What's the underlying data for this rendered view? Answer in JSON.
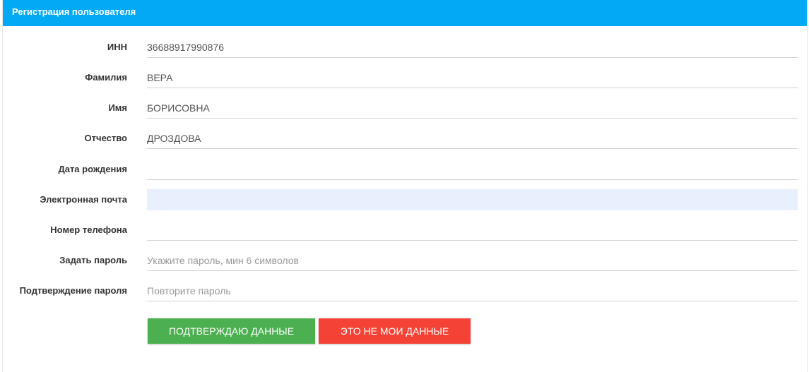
{
  "panel": {
    "title": "Регистрация пользователя"
  },
  "form": {
    "fields": [
      {
        "label": "ИНН",
        "value": "36688917990876",
        "placeholder": ""
      },
      {
        "label": "Фамилия",
        "value": "ВЕРА",
        "placeholder": ""
      },
      {
        "label": "Имя",
        "value": "БОРИСОВНА",
        "placeholder": ""
      },
      {
        "label": "Отчество",
        "value": "ДРОЗДОВА",
        "placeholder": ""
      },
      {
        "label": "Дата рождения",
        "value": "",
        "placeholder": ""
      },
      {
        "label": "Электронная почта",
        "value": "",
        "placeholder": ""
      },
      {
        "label": "Номер телефона",
        "value": "",
        "placeholder": ""
      },
      {
        "label": "Задать пароль",
        "value": "",
        "placeholder": "Укажите пароль, мин 6 символов"
      },
      {
        "label": "Подтверждение пароля",
        "value": "",
        "placeholder": "Повторите пароль"
      }
    ]
  },
  "buttons": {
    "confirm_label": "ПОДТВЕРЖДАЮ ДАННЫЕ",
    "reject_label": "ЭТО НЕ МОИ ДАННЫЕ"
  },
  "colors": {
    "header": "#03a9f4",
    "confirm": "#4caf50",
    "reject": "#f44336",
    "autofill": "#e8f0fe"
  }
}
